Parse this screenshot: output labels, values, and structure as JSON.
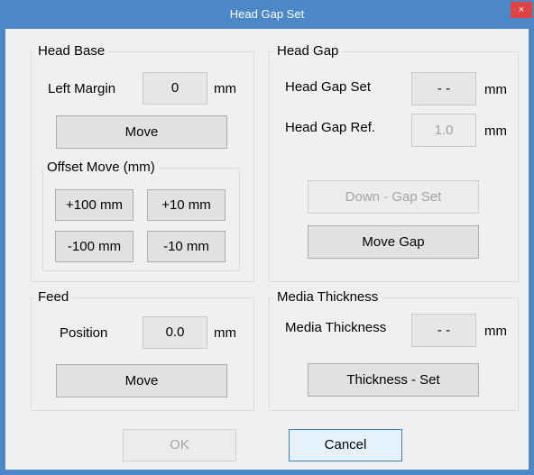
{
  "window": {
    "title": "Head Gap Set",
    "close_glyph": "×"
  },
  "head_base": {
    "group_label": "Head Base",
    "left_margin_label": "Left Margin",
    "left_margin_value": "0",
    "left_margin_unit": "mm",
    "move_label": "Move",
    "offset_group_label": "Offset Move (mm)",
    "offset_buttons": [
      "+100 mm",
      "+10 mm",
      "-100 mm",
      "-10 mm"
    ]
  },
  "head_gap": {
    "group_label": "Head Gap",
    "set_label": "Head Gap Set",
    "set_value": "- -",
    "set_unit": "mm",
    "ref_label": "Head Gap Ref.",
    "ref_value": "1.0",
    "ref_unit": "mm",
    "down_gap_set_label": "Down - Gap Set",
    "move_gap_label": "Move Gap"
  },
  "feed": {
    "group_label": "Feed",
    "position_label": "Position",
    "position_value": "0.0",
    "position_unit": "mm",
    "move_label": "Move"
  },
  "media_thickness": {
    "group_label": "Media Thickness",
    "label": "Media Thickness",
    "value": "- -",
    "unit": "mm",
    "set_label": "Thickness - Set"
  },
  "footer": {
    "ok_label": "OK",
    "cancel_label": "Cancel"
  },
  "colors": {
    "titlebar": "#4c88c8",
    "close": "#e04343",
    "dialog_bg": "#f0f0f0"
  },
  "icons": {
    "close": "close-icon"
  }
}
